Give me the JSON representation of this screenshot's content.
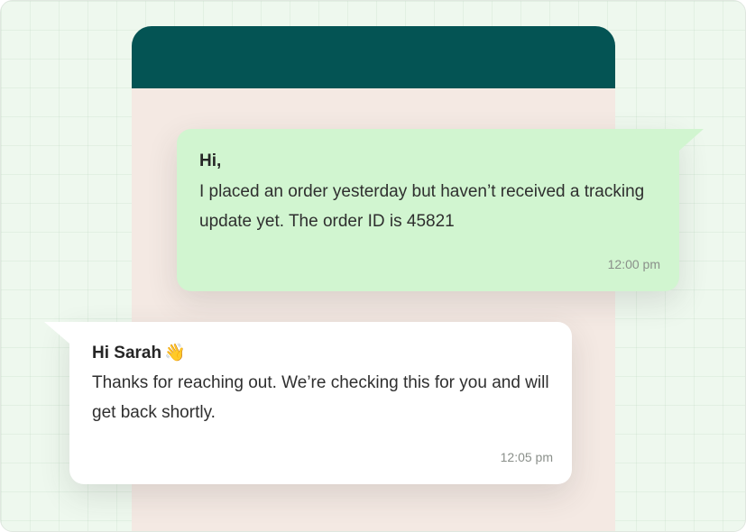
{
  "chat": {
    "outgoing": {
      "greeting": "Hi,",
      "body": "I placed an order yesterday but haven’t received a tracking update yet. The order ID is 45821",
      "time": "12:00 pm"
    },
    "incoming": {
      "greeting": "Hi Sarah",
      "emoji": "👋",
      "body": "Thanks for reaching out. We’re checking this for you and will get back shortly.",
      "time": "12:05 pm"
    }
  },
  "colors": {
    "header": "#045454",
    "chat_background": "#f4e9e3",
    "outgoing_bubble": "#d1f5d0",
    "incoming_bubble": "#ffffff",
    "page_background": "#eef8ee"
  }
}
